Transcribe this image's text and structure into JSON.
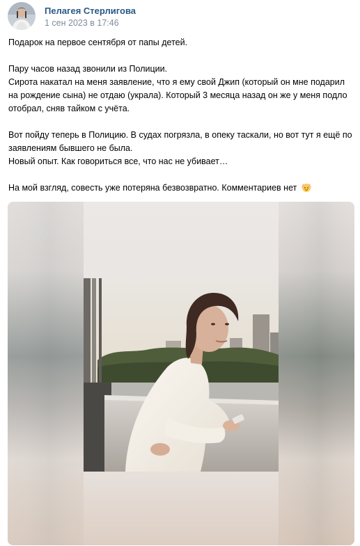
{
  "post": {
    "author": {
      "name": "Пелагея Стерлигова",
      "avatar_icon": "user-avatar"
    },
    "date": "1 сен 2023 в 17:46",
    "text": {
      "line1": "Подарок на первое сентября от папы детей.",
      "line2": "Пару часов назад звонили из Полиции.",
      "line3": "Сирота накатал на меня заявление, что я ему свой Джип (который он мне подарил на рождение сына) не отдаю (украла). Который 3 месяца назад он же у меня подло отобрал, сняв тайком с учёта.",
      "line4": "Вот пойду теперь в Полицию. В судах погрязла, в опеку таскали, но вот тут я ещё по заявлениям бывшего не была.",
      "line5": "Новый опыт. Как говориться все, что нас не убивает…",
      "line6": "На мой взгляд, совесть уже потеряна безвозвратно. Комментариев нет",
      "line6_emoji": "woman-gesturing-ok-emoji"
    },
    "media": {
      "type": "photo",
      "icon": "photo-attachment"
    }
  },
  "colors": {
    "author_link": "#2a5885",
    "date_gray": "#818c99",
    "text": "#000000",
    "background": "#ffffff"
  }
}
